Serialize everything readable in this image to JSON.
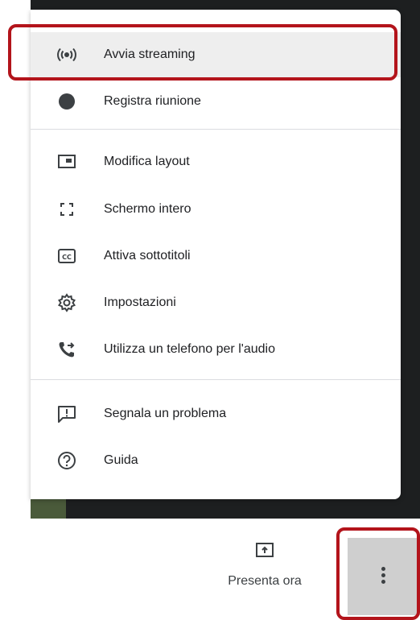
{
  "menu": {
    "items": [
      {
        "label": "Avvia streaming",
        "icon": "live-stream-icon"
      },
      {
        "label": "Registra riunione",
        "icon": "record-dot-icon"
      },
      {
        "label": "Modifica layout",
        "icon": "layout-icon"
      },
      {
        "label": "Schermo intero",
        "icon": "fullscreen-icon"
      },
      {
        "label": "Attiva sottotitoli",
        "icon": "closed-captions-icon"
      },
      {
        "label": "Impostazioni",
        "icon": "gear-icon"
      },
      {
        "label": "Utilizza un telefono per l'audio",
        "icon": "phone-forward-icon"
      },
      {
        "label": "Segnala un problema",
        "icon": "feedback-icon"
      },
      {
        "label": "Guida",
        "icon": "help-icon"
      }
    ]
  },
  "toolbar": {
    "present_label": "Presenta ora",
    "more_options_icon": "more-vert-icon"
  },
  "colors": {
    "highlight_border": "#b3141b",
    "menu_bg": "#ffffff",
    "call_bg": "#1d1f20",
    "more_button_bg": "#cfcfcf"
  }
}
